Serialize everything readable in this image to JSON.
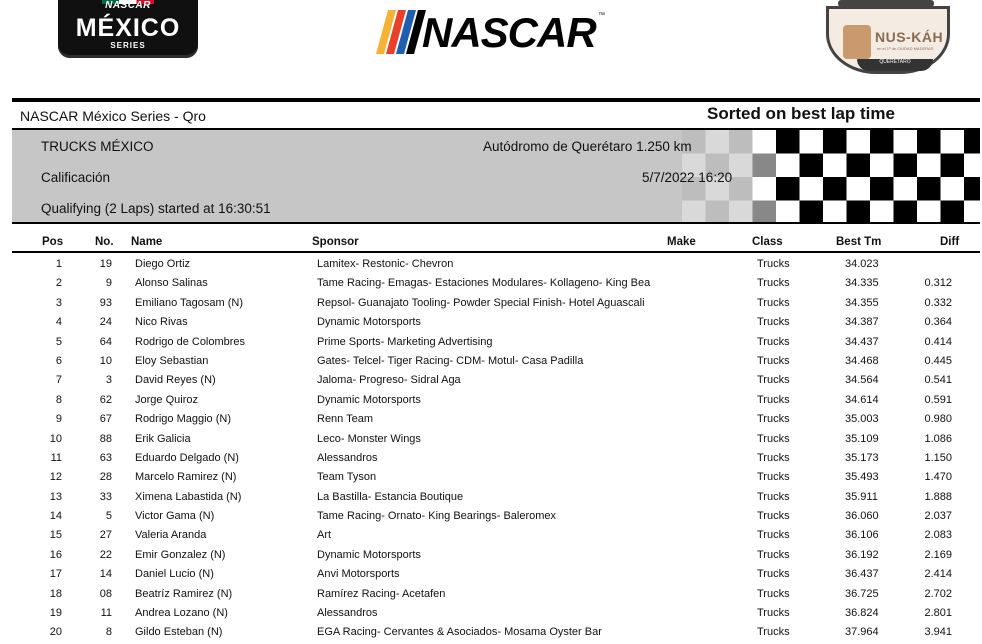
{
  "logos": {
    "mexico": {
      "top": "NASCAR",
      "main": "MÉXICO",
      "sub": "SERIES"
    },
    "nascar": {
      "word": "NASCAR",
      "tm": "™"
    },
    "nuskah": {
      "name": "NUS-KÁH",
      "tagline": "en el 1º de CIUDAD MADERAS",
      "ribbon": "QUERÉTARO"
    }
  },
  "report": {
    "series": "NASCAR México Series - Qro",
    "sort_note": "Sorted on best lap time",
    "class_name": "TRUCKS MÉXICO",
    "session": "Calificación",
    "started": "Qualifying (2 Laps) started at 16:30:51",
    "track": "Autódromo de Querétaro 1.250 km",
    "datetime": "5/7/2022 16:20"
  },
  "columns": {
    "pos": "Pos",
    "no": "No.",
    "name": "Name",
    "sponsor": "Sponsor",
    "make": "Make",
    "class": "Class",
    "best": "Best Tm",
    "diff": "Diff"
  },
  "rows": [
    {
      "pos": "1",
      "no": "19",
      "name": "Diego Ortiz",
      "sponsor": "Lamitex- Restonic- Chevron",
      "make": "",
      "class": "Trucks",
      "best": "34.023",
      "diff": ""
    },
    {
      "pos": "2",
      "no": "9",
      "name": "Alonso Salinas",
      "sponsor": "Tame Racing- Emagas- Estaciones Modulares- Kollageno- King Bea",
      "make": "",
      "class": "Trucks",
      "best": "34.335",
      "diff": "0.312"
    },
    {
      "pos": "3",
      "no": "93",
      "name": "Emiliano Tagosam (N)",
      "sponsor": "Repsol- Guanajato Tooling- Powder Special Finish- Hotel Aguascali",
      "make": "",
      "class": "Trucks",
      "best": "34.355",
      "diff": "0.332"
    },
    {
      "pos": "4",
      "no": "24",
      "name": "Nico Rivas",
      "sponsor": "Dynamic Motorsports",
      "make": "",
      "class": "Trucks",
      "best": "34.387",
      "diff": "0.364"
    },
    {
      "pos": "5",
      "no": "64",
      "name": "Rodrigo de Colombres",
      "sponsor": "Prime Sports- Marketing Advertising",
      "make": "",
      "class": "Trucks",
      "best": "34.437",
      "diff": "0.414"
    },
    {
      "pos": "6",
      "no": "10",
      "name": "Eloy Sebastian",
      "sponsor": "Gates- Telcel- Tiger Racing- CDM- Motul- Casa Padilla",
      "make": "",
      "class": "Trucks",
      "best": "34.468",
      "diff": "0.445"
    },
    {
      "pos": "7",
      "no": "3",
      "name": "David Reyes (N)",
      "sponsor": "Jaloma- Progreso- Sidral Aga",
      "make": "",
      "class": "Trucks",
      "best": "34.564",
      "diff": "0.541"
    },
    {
      "pos": "8",
      "no": "62",
      "name": "Jorge Quiroz",
      "sponsor": "Dynamic Motorsports",
      "make": "",
      "class": "Trucks",
      "best": "34.614",
      "diff": "0.591"
    },
    {
      "pos": "9",
      "no": "67",
      "name": "Rodrigo Maggio (N)",
      "sponsor": "Renn Team",
      "make": "",
      "class": "Trucks",
      "best": "35.003",
      "diff": "0.980"
    },
    {
      "pos": "10",
      "no": "88",
      "name": "Erik Galicia",
      "sponsor": "Leco- Monster Wings",
      "make": "",
      "class": "Trucks",
      "best": "35.109",
      "diff": "1.086"
    },
    {
      "pos": "11",
      "no": "63",
      "name": "Eduardo Delgado (N)",
      "sponsor": "Alessandros",
      "make": "",
      "class": "Trucks",
      "best": "35.173",
      "diff": "1.150"
    },
    {
      "pos": "12",
      "no": "28",
      "name": "Marcelo Ramirez (N)",
      "sponsor": "Team Tyson",
      "make": "",
      "class": "Trucks",
      "best": "35.493",
      "diff": "1.470"
    },
    {
      "pos": "13",
      "no": "33",
      "name": "Ximena Labastida (N)",
      "sponsor": "La Bastilla- Estancia Boutique",
      "make": "",
      "class": "Trucks",
      "best": "35.911",
      "diff": "1.888"
    },
    {
      "pos": "14",
      "no": "5",
      "name": "Victor Gama (N)",
      "sponsor": "Tame Racing- Ornato- King Bearings- Baleromex",
      "make": "",
      "class": "Trucks",
      "best": "36.060",
      "diff": "2.037"
    },
    {
      "pos": "15",
      "no": "27",
      "name": "Valeria Aranda",
      "sponsor": "Art",
      "make": "",
      "class": "Trucks",
      "best": "36.106",
      "diff": "2.083"
    },
    {
      "pos": "16",
      "no": "22",
      "name": "Emir Gonzalez (N)",
      "sponsor": "Dynamic Motorsports",
      "make": "",
      "class": "Trucks",
      "best": "36.192",
      "diff": "2.169"
    },
    {
      "pos": "17",
      "no": "14",
      "name": "Daniel Lucio (N)",
      "sponsor": "Anvi Motorsports",
      "make": "",
      "class": "Trucks",
      "best": "36.437",
      "diff": "2.414"
    },
    {
      "pos": "18",
      "no": "08",
      "name": "Beatríz Ramirez (N)",
      "sponsor": "Ramírez Racing- Acetafen",
      "make": "",
      "class": "Trucks",
      "best": "36.725",
      "diff": "2.702"
    },
    {
      "pos": "19",
      "no": "11",
      "name": "Andrea Lozano (N)",
      "sponsor": "Alessandros",
      "make": "",
      "class": "Trucks",
      "best": "36.824",
      "diff": "2.801"
    },
    {
      "pos": "20",
      "no": "8",
      "name": "Gildo Esteban (N)",
      "sponsor": "EGA Racing- Cervantes & Asociados- Mosama Oyster Bar",
      "make": "",
      "class": "Trucks",
      "best": "37.964",
      "diff": "3.941"
    }
  ]
}
